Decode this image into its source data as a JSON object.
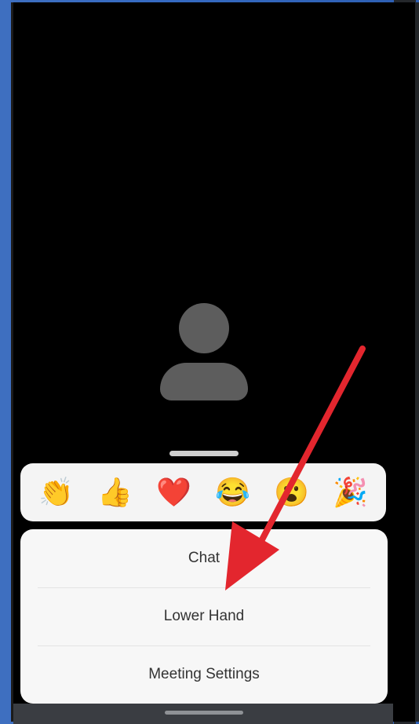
{
  "reactions": [
    {
      "name": "clap",
      "emoji": "👏"
    },
    {
      "name": "thumbs-up",
      "emoji": "👍"
    },
    {
      "name": "heart",
      "emoji": "❤️"
    },
    {
      "name": "tears-of-joy",
      "emoji": "😂"
    },
    {
      "name": "surprised",
      "emoji": "😮"
    },
    {
      "name": "party",
      "emoji": "🎉"
    }
  ],
  "menu": {
    "chat": "Chat",
    "lower_hand": "Lower Hand",
    "meeting_settings": "Meeting Settings"
  },
  "colors": {
    "arrow": "#e3262e",
    "sheet": "#f7f7f7",
    "avatar": "#5d5d5d"
  }
}
